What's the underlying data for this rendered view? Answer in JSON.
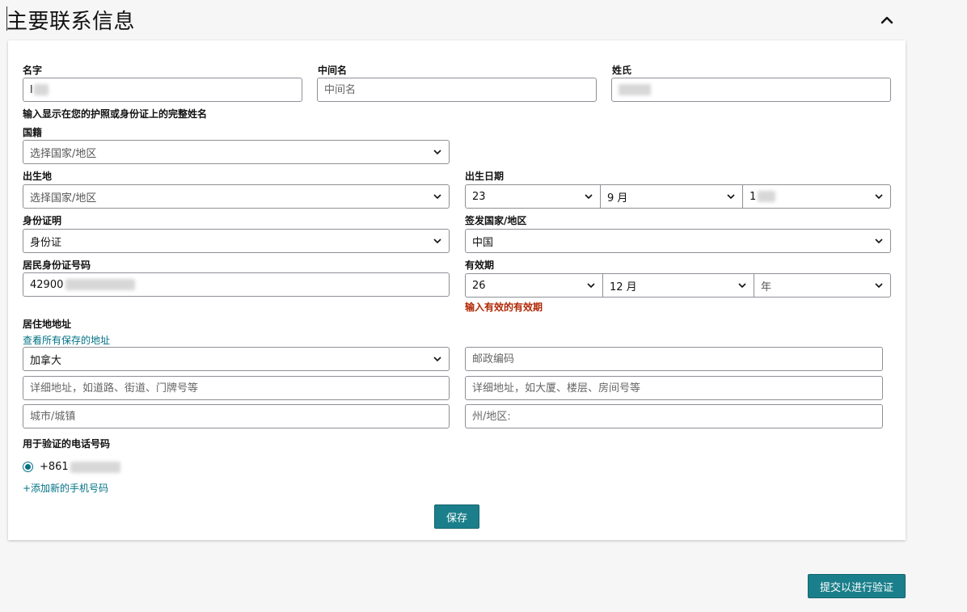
{
  "page": {
    "title": "主要联系信息"
  },
  "name": {
    "first_label": "名字",
    "first_value": "l",
    "middle_label": "中间名",
    "middle_placeholder": "中间名",
    "last_label": "姓氏",
    "hint": "输入显示在您的护照或身份证上的完整姓名"
  },
  "nationality": {
    "label": "国籍",
    "value": "选择国家/地区"
  },
  "birthplace": {
    "label": "出生地",
    "value": "选择国家/地区"
  },
  "dob": {
    "label": "出生日期",
    "day": "23",
    "month": "9 月",
    "year": "1"
  },
  "id_doc": {
    "label": "身份证明",
    "value": "身份证"
  },
  "issuing": {
    "label": "签发国家/地区",
    "value": "中国"
  },
  "id_number": {
    "label": "居民身份证号码",
    "value": "42900"
  },
  "expiry": {
    "label": "有效期",
    "day": "26",
    "month": "12 月",
    "year": "年",
    "error": "输入有效的有效期"
  },
  "address": {
    "label": "居住地地址",
    "saved_link": "查看所有保存的地址",
    "country": "加拿大",
    "postal_placeholder": "邮政编码",
    "line1_placeholder": "详细地址，如道路、街道、门牌号等",
    "line2_placeholder": "详细地址，如大厦、楼层、房间号等",
    "city_placeholder": "城市/城镇",
    "state_placeholder": "州/地区:"
  },
  "phone": {
    "label": "用于验证的电话号码",
    "number": "+861",
    "add_link": "+添加新的手机号码"
  },
  "actions": {
    "save": "保存",
    "submit": "提交以进行验证"
  },
  "colors": {
    "teal": "#1b7f8b",
    "link": "#007185",
    "error": "#b12704",
    "border": "#8d9096"
  }
}
